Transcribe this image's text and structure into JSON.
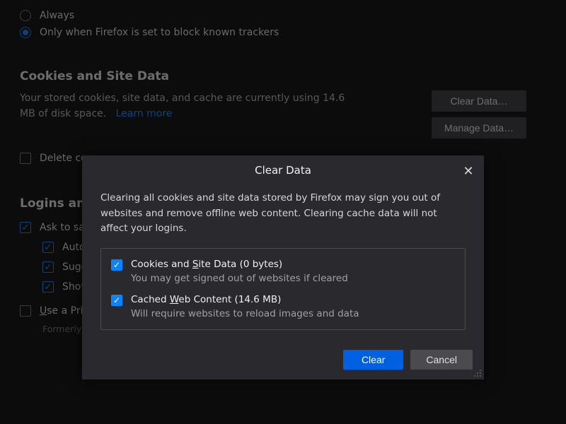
{
  "tracking": {
    "always": "Always",
    "onlyWhenBlocking": "Only when Firefox is set to block known trackers"
  },
  "cookies": {
    "heading": "Cookies and Site Data",
    "descPrefix": "Your stored cookies, site data, and cache are currently using ",
    "size": "14.6 MB",
    "descSuffix": " of disk space.",
    "learnMore": "Learn more",
    "clearDataBtn": "Clear Data…",
    "manageDataBtn": "Manage Data…",
    "deleteOnClose": "Delete co"
  },
  "logins": {
    "heading": "Logins and",
    "askToSave": "Ask to sa",
    "auto": "Auto",
    "sugg": "Sugg",
    "show": "Show",
    "usePrimary": "Use a Prin",
    "formerly": "Formerly "
  },
  "dialog": {
    "title": "Clear Data",
    "text": "Clearing all cookies and site data stored by Firefox may sign you out of websites and remove offline web content. Clearing cache data will not affect your logins.",
    "opt1Label": "Cookies and Site Data (0 bytes)",
    "opt1Sub": "You may get signed out of websites if cleared",
    "opt2Label": "Cached Web Content (14.6 MB)",
    "opt2Sub": "Will require websites to reload images and data",
    "clear": "Clear",
    "cancel": "Cancel"
  }
}
